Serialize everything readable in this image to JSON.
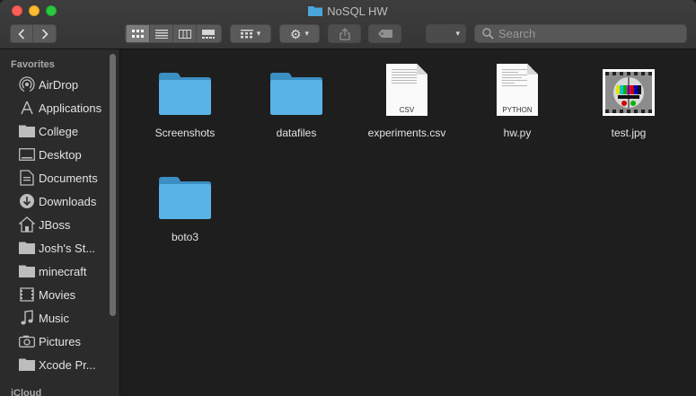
{
  "window": {
    "title": "NoSQL HW",
    "colors": {
      "folder": "#4aa6dc",
      "background": "#1e1e1e",
      "sidebar": "#2b2b2b"
    }
  },
  "toolbar": {
    "back_icon": "chevron-left-icon",
    "forward_icon": "chevron-right-icon",
    "views": [
      "icon-view",
      "list-view",
      "column-view",
      "gallery-view"
    ],
    "active_view": "icon-view",
    "group_icon": "grid-icon",
    "action_icon": "gear-icon",
    "share_icon": "share-icon",
    "tags_icon": "tag-icon"
  },
  "search": {
    "placeholder": "Search"
  },
  "sidebar": {
    "heading": "Favorites",
    "items": [
      {
        "label": "AirDrop",
        "icon": "airdrop-icon"
      },
      {
        "label": "Applications",
        "icon": "applications-icon"
      },
      {
        "label": "College",
        "icon": "folder-icon"
      },
      {
        "label": "Desktop",
        "icon": "desktop-icon"
      },
      {
        "label": "Documents",
        "icon": "documents-icon"
      },
      {
        "label": "Downloads",
        "icon": "downloads-icon"
      },
      {
        "label": "JBoss",
        "icon": "home-icon"
      },
      {
        "label": "Josh's St...",
        "icon": "folder-icon"
      },
      {
        "label": "minecraft",
        "icon": "folder-icon"
      },
      {
        "label": "Movies",
        "icon": "movies-icon"
      },
      {
        "label": "Music",
        "icon": "music-icon"
      },
      {
        "label": "Pictures",
        "icon": "pictures-icon"
      },
      {
        "label": "Xcode Pr...",
        "icon": "folder-icon"
      }
    ],
    "footer": "iCloud"
  },
  "files": [
    {
      "name": "Screenshots",
      "kind": "folder"
    },
    {
      "name": "datafiles",
      "kind": "folder"
    },
    {
      "name": "experiments.csv",
      "kind": "document",
      "tag": "CSV"
    },
    {
      "name": "hw.py",
      "kind": "document",
      "tag": "PYTHON"
    },
    {
      "name": "test.jpg",
      "kind": "image"
    },
    {
      "name": "boto3",
      "kind": "folder"
    }
  ]
}
